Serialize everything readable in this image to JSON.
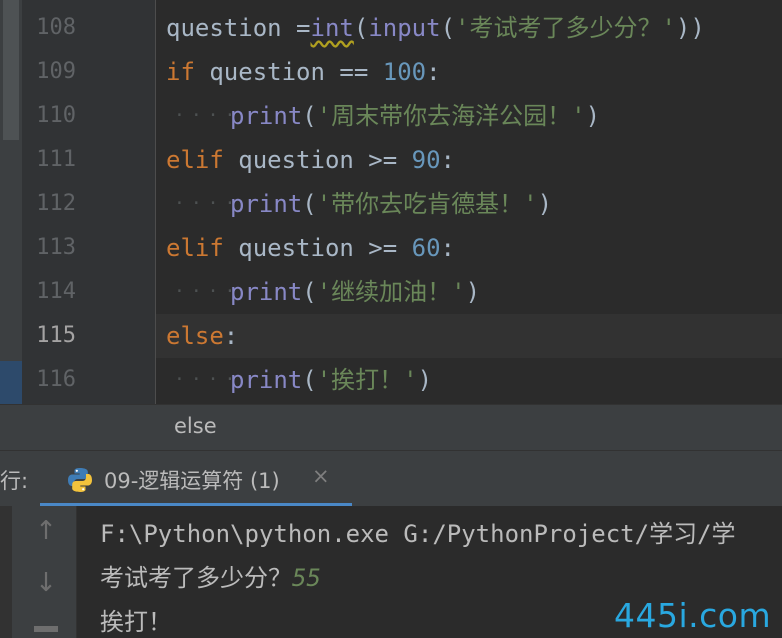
{
  "editor": {
    "line_numbers": [
      "108",
      "109",
      "110",
      "111",
      "112",
      "113",
      "114",
      "115",
      "116"
    ],
    "current_line": "115",
    "lines": [
      {
        "tokens": [
          {
            "t": "question ",
            "c": "pl"
          },
          {
            "t": "=",
            "c": "pl"
          },
          {
            "t": "int",
            "c": "bi sq"
          },
          {
            "t": "(",
            "c": "pl"
          },
          {
            "t": "input",
            "c": "bi"
          },
          {
            "t": "(",
            "c": "pl"
          },
          {
            "t": "'考试考了多少分？'",
            "c": "st"
          },
          {
            "t": "))",
            "c": "pl"
          }
        ]
      },
      {
        "tokens": [
          {
            "t": "if",
            "c": "kw"
          },
          {
            "t": " question == ",
            "c": "pl"
          },
          {
            "t": "100",
            "c": "nm"
          },
          {
            "t": ":",
            "c": "pl"
          }
        ]
      },
      {
        "tokens": [
          {
            "t": "print",
            "c": "bi"
          },
          {
            "t": "(",
            "c": "pl"
          },
          {
            "t": "'周末带你去海洋公园！'",
            "c": "st"
          },
          {
            "t": ")",
            "c": "pl"
          }
        ]
      },
      {
        "tokens": [
          {
            "t": "elif",
            "c": "kw"
          },
          {
            "t": " question >= ",
            "c": "pl"
          },
          {
            "t": "90",
            "c": "nm"
          },
          {
            "t": ":",
            "c": "pl"
          }
        ]
      },
      {
        "tokens": [
          {
            "t": "print",
            "c": "bi"
          },
          {
            "t": "(",
            "c": "pl"
          },
          {
            "t": "'带你去吃肯德基！'",
            "c": "st"
          },
          {
            "t": ")",
            "c": "pl"
          }
        ]
      },
      {
        "tokens": [
          {
            "t": "elif",
            "c": "kw"
          },
          {
            "t": " question >= ",
            "c": "pl"
          },
          {
            "t": "60",
            "c": "nm"
          },
          {
            "t": ":",
            "c": "pl"
          }
        ]
      },
      {
        "tokens": [
          {
            "t": "print",
            "c": "bi"
          },
          {
            "t": "(",
            "c": "pl"
          },
          {
            "t": "'继续加油！'",
            "c": "st"
          },
          {
            "t": ")",
            "c": "pl"
          }
        ]
      },
      {
        "tokens": [
          {
            "t": "else",
            "c": "kw"
          },
          {
            "t": ":",
            "c": "pl"
          }
        ]
      },
      {
        "tokens": [
          {
            "t": "print",
            "c": "bi"
          },
          {
            "t": "(",
            "c": "pl"
          },
          {
            "t": "'挨打！'",
            "c": "st"
          },
          {
            "t": ")",
            "c": "pl"
          }
        ]
      }
    ]
  },
  "breadcrumb": "else",
  "run": {
    "label": "行:",
    "tab_label": "09-逻辑运算符 (1)",
    "close_glyph": "×",
    "up_glyph": "↑",
    "down_glyph": "↓",
    "output": {
      "line1": "F:\\Python\\python.exe G:/PythonProject/学习/学",
      "prompt": "考试考了多少分？",
      "user_input": "55",
      "line3": "挨打！"
    }
  },
  "watermark": "445i.com",
  "colors": {
    "keyword": "#cc7832",
    "builtin": "#8888c6",
    "string": "#6a8759",
    "number": "#6897bb",
    "plain": "#a9b7c6",
    "accent": "#4a88c7",
    "watermark": "#29a8e0"
  }
}
